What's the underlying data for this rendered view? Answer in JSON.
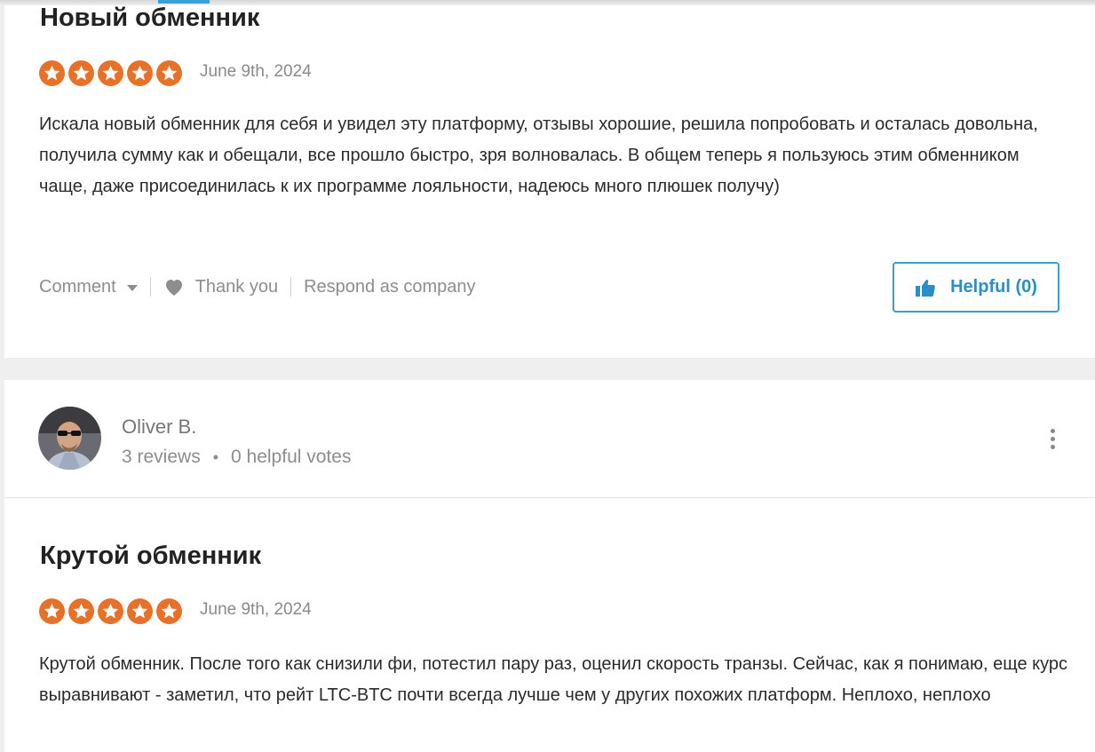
{
  "reviews": [
    {
      "title": "Новый обменник",
      "rating": 5,
      "date": "June 9th, 2024",
      "text": "Искала новый обменник для себя и увидел эту платформу, отзывы хорошие, решила попробовать и осталась довольна, получила сумму как и обещали, все прошло быстро, зря волновалась. В общем теперь я пользуюсь этим обменником чаще, даже присоединилась к их программе лояльности, надеюсь много плюшек получу)",
      "actions": {
        "comment": "Comment",
        "thank_you": "Thank you",
        "respond": "Respond as company",
        "helpful": "Helpful (0)"
      }
    },
    {
      "author": {
        "name": "Oliver B.",
        "reviews": "3 reviews",
        "votes": "0 helpful votes"
      },
      "title": "Крутой обменник",
      "rating": 5,
      "date": "June 9th, 2024",
      "text": "Крутой обменник. После того как снизили фи, потестил пару раз, оценил скорость транзы. Сейчас, как я понимаю, еще курс выравнивают - заметил, что рейт LTC-BTC почти всегда лучше чем у других похожих платформ. Неплохо, неплохо"
    }
  ],
  "colors": {
    "star": "#e8712a",
    "accent": "#3a9fcd",
    "muted_text": "#8d8d8d"
  },
  "icons": [
    "star-icon",
    "chevron-down-icon",
    "heart-icon",
    "thumbs-up-icon",
    "more-vertical-icon"
  ]
}
